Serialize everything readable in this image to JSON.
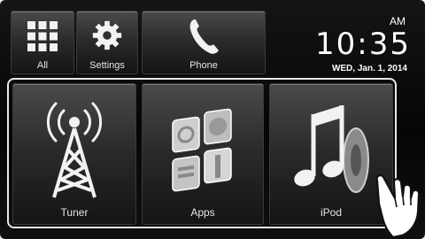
{
  "clock": {
    "ampm": "AM",
    "time": "10:35",
    "date": "WED, Jan. 1, 2014"
  },
  "top_buttons": [
    {
      "label": "All",
      "icon": "grid-icon"
    },
    {
      "label": "Settings",
      "icon": "gear-icon"
    },
    {
      "label": "Phone",
      "icon": "phone-icon"
    }
  ],
  "main_buttons": [
    {
      "label": "Tuner",
      "icon": "antenna-tower-icon"
    },
    {
      "label": "Apps",
      "icon": "apps-tiles-icon"
    },
    {
      "label": "iPod",
      "icon": "music-note-icon"
    }
  ],
  "colors": {
    "background": "#0a0a0a",
    "button_top": "#4a4a4a",
    "button_bottom": "#141414",
    "text": "#e6e6e6",
    "highlight_frame": "#e8e8e8"
  }
}
